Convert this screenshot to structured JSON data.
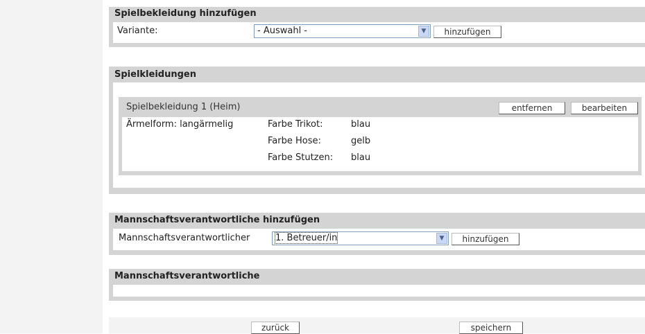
{
  "panel_add_clothing": {
    "title": "Spielbekleidung hinzufügen",
    "variant_label": "Variante:",
    "variant_select_value": "- Auswahl -",
    "add_button": "hinzufügen"
  },
  "panel_clothings": {
    "title": "Spielkleidungen",
    "item": {
      "title": "Spielbekleidung 1 (Heim)",
      "remove_button": "entfernen",
      "edit_button": "bearbeiten",
      "sleeve": "Ärmelform: langärmelig",
      "rows": [
        {
          "label": "Farbe Trikot:",
          "value": "blau"
        },
        {
          "label": "Farbe Hose:",
          "value": "gelb"
        },
        {
          "label": "Farbe Stutzen:",
          "value": "blau"
        }
      ]
    }
  },
  "panel_add_manager": {
    "title": "Mannschaftsverantwortliche hinzufügen",
    "manager_label": "Mannschaftsverantwortlicher",
    "manager_select_value": "1. Betreuer/in",
    "add_button": "hinzufügen"
  },
  "panel_managers": {
    "title": "Mannschaftsverantwortliche"
  },
  "footer": {
    "back_button": "zurück",
    "save_button": "speichern"
  }
}
